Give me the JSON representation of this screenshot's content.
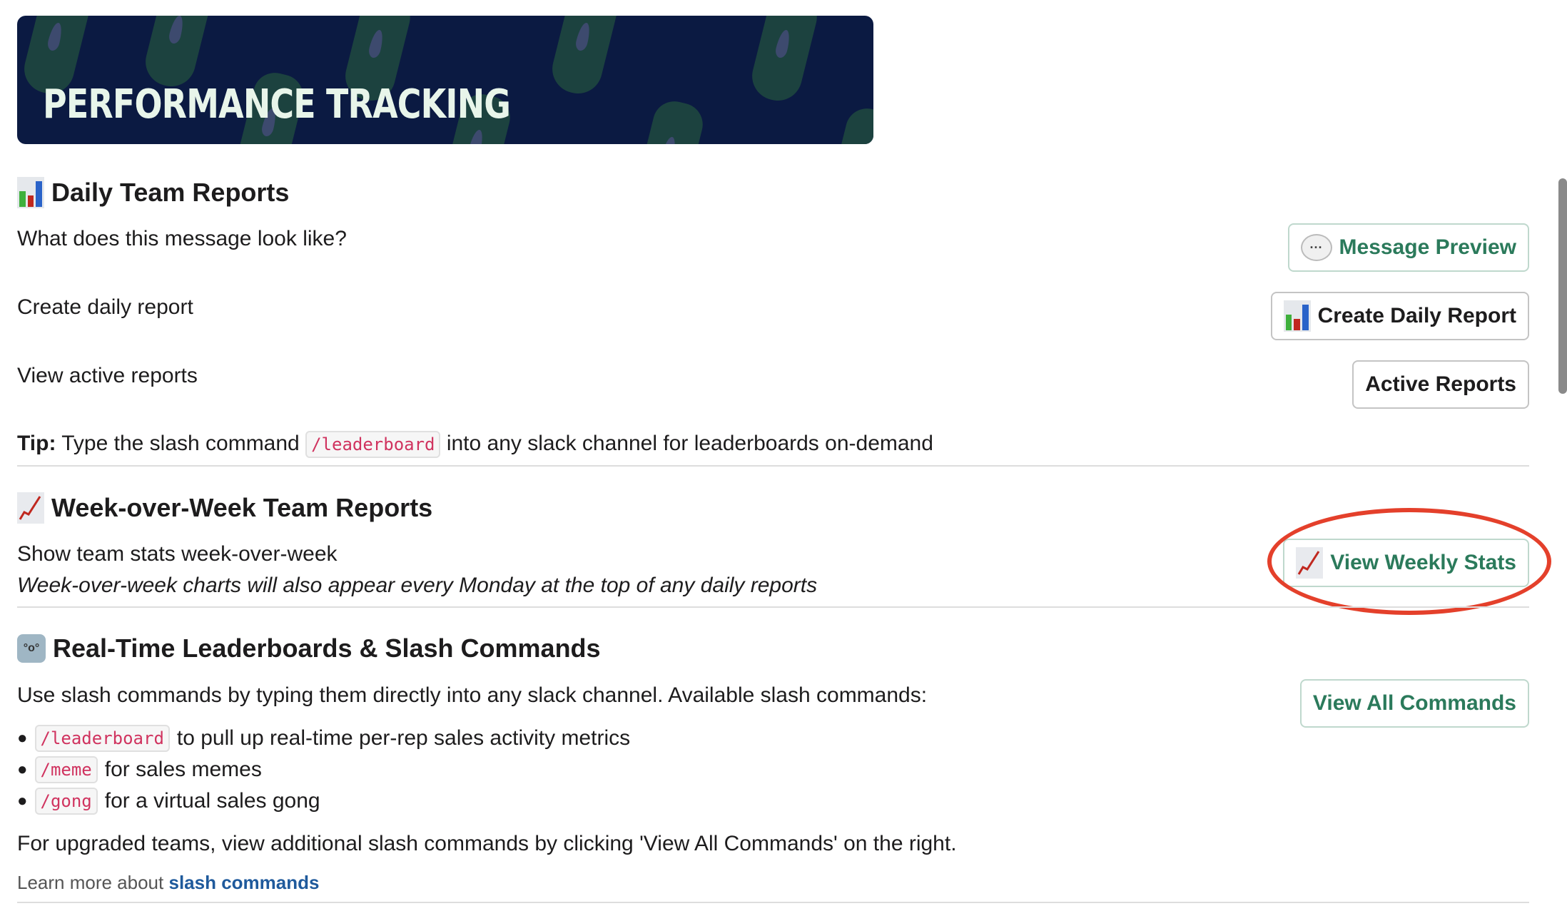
{
  "banner": {
    "title": "PERFORMANCE TRACKING"
  },
  "sections": {
    "daily": {
      "heading": "Daily Team Reports",
      "icon": "bar-chart-icon",
      "rows": [
        {
          "label": "What does this message look like?",
          "button": "Message Preview",
          "button_icon": "speech-bubble-icon"
        },
        {
          "label": "Create daily report",
          "button": "Create Daily Report",
          "button_icon": "bar-chart-icon"
        },
        {
          "label": "View active reports",
          "button": "Active Reports"
        }
      ],
      "tip": {
        "bold": "Tip:",
        "before": "Type the slash command",
        "code": "/leaderboard",
        "after": "into any slack channel for leaderboards on-demand"
      }
    },
    "weekly": {
      "heading": "Week-over-Week Team Reports",
      "icon": "chart-increasing-icon",
      "line1": "Show team stats week-over-week",
      "line2": "Week-over-week charts will also appear every Monday at the top of any daily reports",
      "button": "View Weekly Stats"
    },
    "commands": {
      "heading": "Real-Time Leaderboards & Slash Commands",
      "icon": "robot-icon",
      "intro": "Use slash commands by typing them directly into any slack channel. Available slash commands:",
      "button": "View All Commands",
      "items": [
        {
          "code": "/leaderboard",
          "text": "to pull up real-time per-rep sales activity metrics"
        },
        {
          "code": "/meme",
          "text": "for sales memes"
        },
        {
          "code": "/gong",
          "text": "for a virtual sales gong"
        }
      ],
      "footer": "For upgraded teams, view additional slash commands by clicking 'View All Commands' on the right.",
      "learn_more": "Learn more about",
      "learn_more_link": "slash commands"
    }
  },
  "colors": {
    "accent_green": "#2b7a5b",
    "code_red": "#d0335f",
    "banner_bg": "#0b1a42",
    "highlight": "#e4402b",
    "link": "#1f5a9c"
  }
}
